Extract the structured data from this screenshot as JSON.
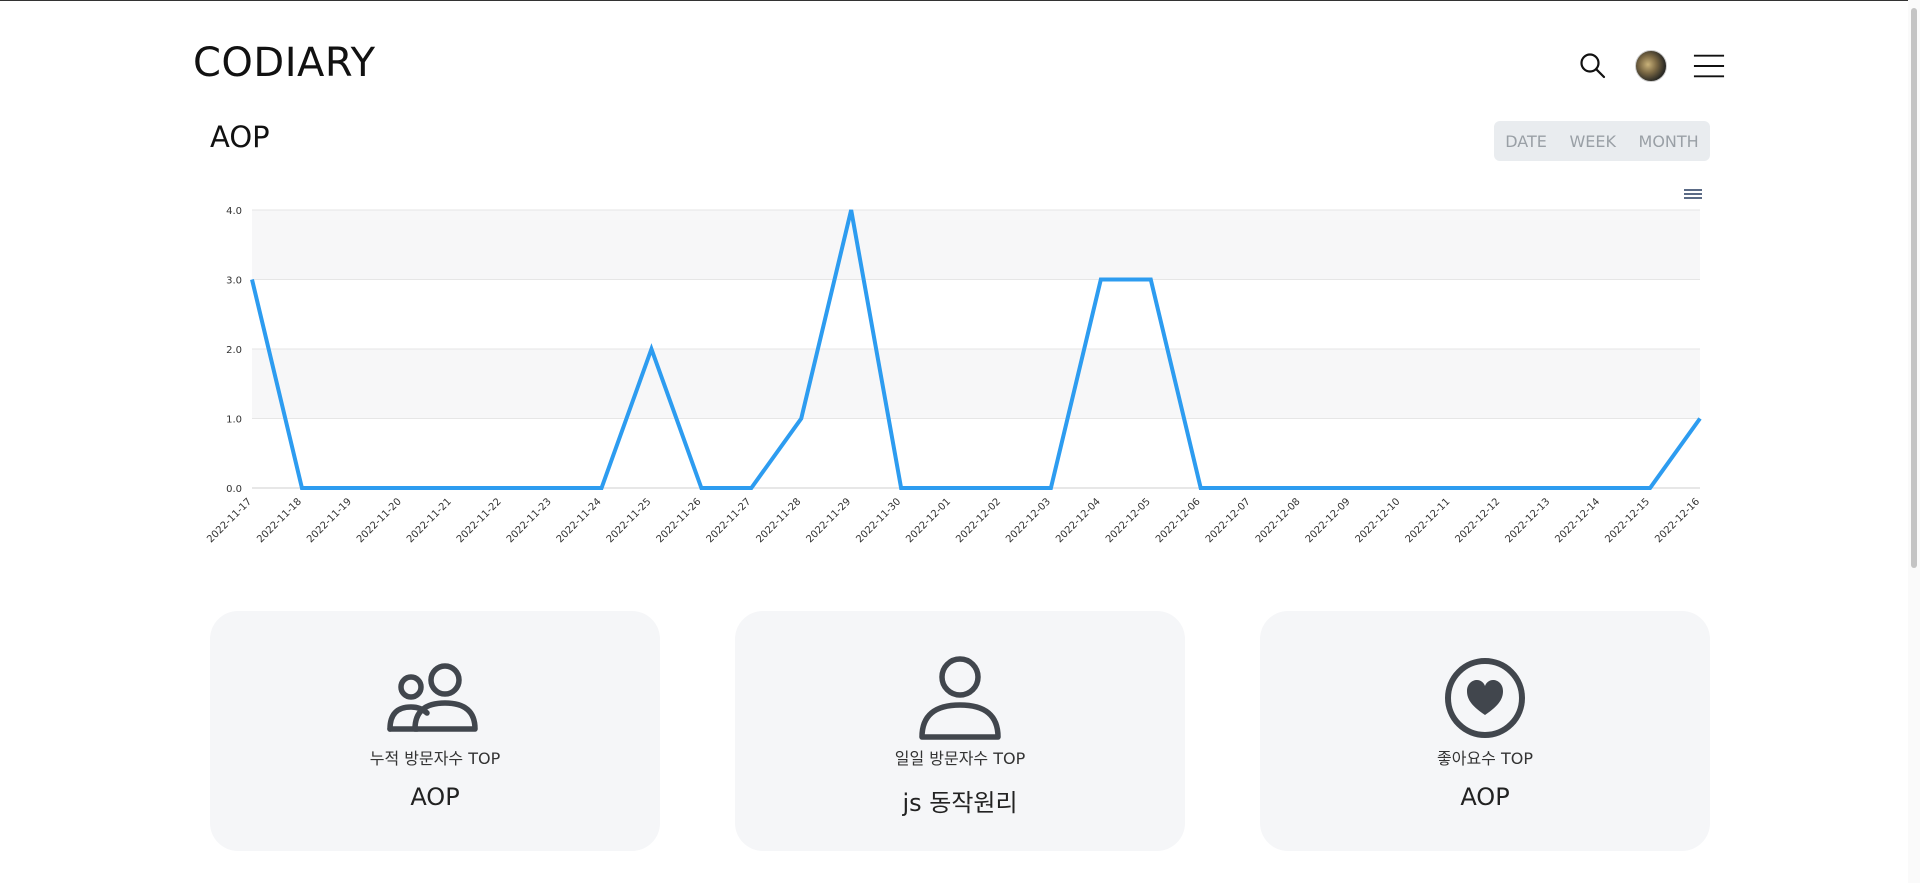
{
  "header": {
    "logo": "CODIARY",
    "search_icon": "search-icon",
    "avatar_icon": "avatar",
    "menu_icon": "hamburger-menu-icon"
  },
  "page": {
    "title": "AOP",
    "period_buttons": [
      "DATE",
      "WEEK",
      "MONTH"
    ]
  },
  "colors": {
    "line": "#2d9cf0",
    "card_bg": "#f5f6f8",
    "icon": "#41464d"
  },
  "chart_data": {
    "type": "line",
    "x": [
      "2022-11-17",
      "2022-11-18",
      "2022-11-19",
      "2022-11-20",
      "2022-11-21",
      "2022-11-22",
      "2022-11-23",
      "2022-11-24",
      "2022-11-25",
      "2022-11-26",
      "2022-11-27",
      "2022-11-28",
      "2022-11-29",
      "2022-11-30",
      "2022-12-01",
      "2022-12-02",
      "2022-12-03",
      "2022-12-04",
      "2022-12-05",
      "2022-12-06",
      "2022-12-07",
      "2022-12-08",
      "2022-12-09",
      "2022-12-10",
      "2022-12-11",
      "2022-12-12",
      "2022-12-13",
      "2022-12-14",
      "2022-12-15",
      "2022-12-16"
    ],
    "series": [
      {
        "values": [
          3,
          0,
          0,
          0,
          0,
          0,
          0,
          0,
          2,
          0,
          0,
          1,
          4,
          0,
          0,
          0,
          0,
          3,
          3,
          0,
          0,
          0,
          0,
          0,
          0,
          0,
          0,
          0,
          0,
          1
        ]
      }
    ],
    "yticks": [
      "0.0",
      "1.0",
      "2.0",
      "3.0",
      "4.0"
    ],
    "ylim": [
      0,
      4
    ],
    "grid": true
  },
  "cards": [
    {
      "icon": "users-icon",
      "label": "누적 방문자수 TOP",
      "value": "AOP"
    },
    {
      "icon": "user-icon",
      "label": "일일 방문자수 TOP",
      "value": "js 동작원리"
    },
    {
      "icon": "heart-circle-icon",
      "label": "좋아요수 TOP",
      "value": "AOP"
    }
  ]
}
